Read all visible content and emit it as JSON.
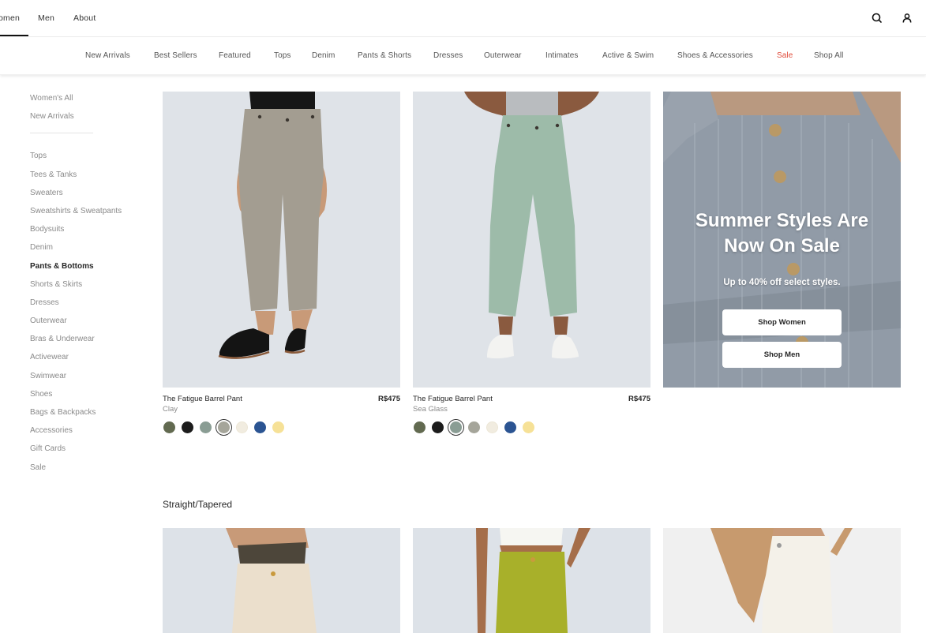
{
  "topbar": {
    "tabs": [
      {
        "label": "omen",
        "active": true
      },
      {
        "label": "Men",
        "active": false
      },
      {
        "label": "About",
        "active": false
      }
    ],
    "icons": [
      "search-icon",
      "account-icon"
    ]
  },
  "catnav": {
    "items": [
      {
        "label": "New Arrivals"
      },
      {
        "label": "Best Sellers"
      },
      {
        "label": "Featured"
      },
      {
        "label": "Tops"
      },
      {
        "label": "Denim"
      },
      {
        "label": "Pants & Shorts"
      },
      {
        "label": "Dresses"
      },
      {
        "label": "Outerwear"
      },
      {
        "label": "Intimates"
      },
      {
        "label": "Active & Swim"
      },
      {
        "label": "Shoes & Accessories"
      },
      {
        "label": "Sale",
        "highlight": true
      },
      {
        "label": "Shop All"
      }
    ],
    "sale_color": "#e04b3a"
  },
  "sidebar": {
    "top_items": [
      {
        "label": "Women's All"
      },
      {
        "label": "New Arrivals"
      }
    ],
    "items": [
      {
        "label": "Tops"
      },
      {
        "label": "Tees & Tanks"
      },
      {
        "label": "Sweaters"
      },
      {
        "label": "Sweatshirts & Sweatpants"
      },
      {
        "label": "Bodysuits"
      },
      {
        "label": "Denim"
      },
      {
        "label": "Pants & Bottoms",
        "active": true
      },
      {
        "label": "Shorts & Skirts"
      },
      {
        "label": "Dresses"
      },
      {
        "label": "Outerwear"
      },
      {
        "label": "Bras & Underwear"
      },
      {
        "label": "Activewear"
      },
      {
        "label": "Swimwear"
      },
      {
        "label": "Shoes"
      },
      {
        "label": "Bags & Backpacks"
      },
      {
        "label": "Accessories"
      },
      {
        "label": "Gift Cards"
      },
      {
        "label": "Sale"
      }
    ]
  },
  "products": [
    {
      "title": "The Fatigue Barrel Pant",
      "color": "Clay",
      "price": "R$475",
      "pant_color": "#a39d91",
      "swatches": [
        "#626a50",
        "#1c1c1c",
        "#8a9d94",
        "#a5a59a",
        "#f1ece0",
        "#2b5492",
        "#f6e197"
      ],
      "selected_swatch": 3
    },
    {
      "title": "The Fatigue Barrel Pant",
      "color": "Sea Glass",
      "price": "R$475",
      "pant_color": "#9dbba9",
      "swatches": [
        "#626a50",
        "#1c1c1c",
        "#8a9d94",
        "#a5a59a",
        "#f1ece0",
        "#2b5492",
        "#f6e197"
      ],
      "selected_swatch": 2
    }
  ],
  "promo": {
    "headline_line1": "Summer Styles Are",
    "headline_line2": "Now On Sale",
    "subtext": "Up to 40% off select styles.",
    "btn_women": "Shop Women",
    "btn_men": "Shop Men"
  },
  "section": {
    "title": "Straight/Tapered",
    "thumbs": [
      {
        "pant_color": "#ebdfcc",
        "top_color": "#4d463a"
      },
      {
        "pant_color": "#a8b02a",
        "top_color": "#f6f6f2"
      },
      {
        "pant_color": "#f4f1e9",
        "top_color": "#c79a6e"
      }
    ]
  }
}
